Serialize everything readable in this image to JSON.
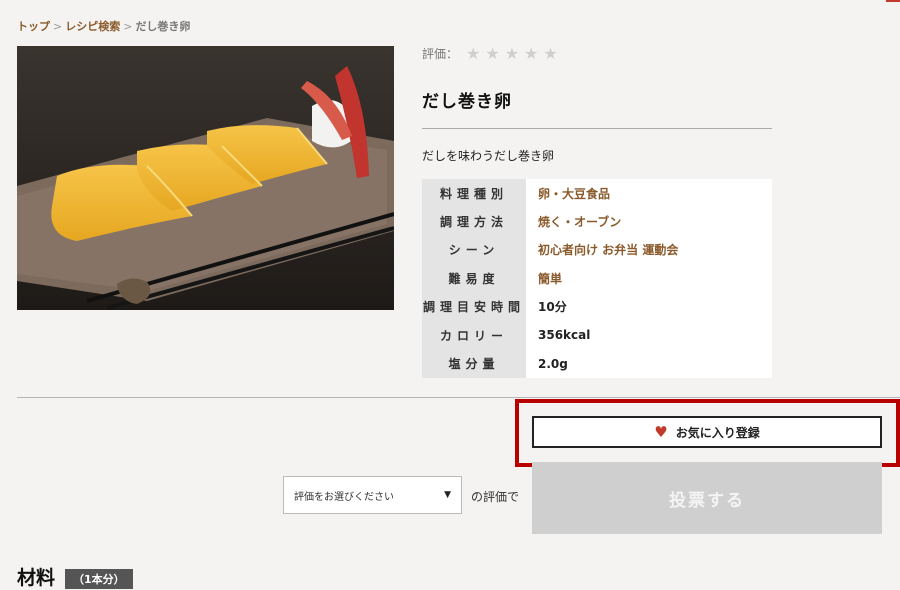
{
  "breadcrumb": {
    "home": "トップ",
    "search": "レシピ検索",
    "current": "だし巻き卵",
    "separator": ">"
  },
  "rating": {
    "label": "評価：",
    "max_stars": 5,
    "filled": 0
  },
  "recipe": {
    "title": "だし巻き卵",
    "description": "だしを味わうだし巻き卵",
    "info": [
      {
        "label": "料理種別",
        "value": "卵・大豆食品",
        "link": true
      },
      {
        "label": "調理方法",
        "value": "焼く・オーブン",
        "link": true
      },
      {
        "label": "シーン",
        "value": "初心者向け お弁当 運動会",
        "link": true
      },
      {
        "label": "難易度",
        "value": "簡単",
        "link": true
      },
      {
        "label": "調理目安時間",
        "value": "10分",
        "link": false
      },
      {
        "label": "カロリー",
        "value": "356kcal",
        "link": false
      },
      {
        "label": "塩分量",
        "value": "2.0g",
        "link": false
      }
    ]
  },
  "favorite": {
    "label": "お気に入り登録"
  },
  "vote": {
    "select_value": "評価をお選びください",
    "suffix": "の評価で",
    "button_label": "投票する"
  },
  "ingredients": {
    "title": "材料",
    "serving": "（1本分）"
  },
  "colors": {
    "accent": "#b80000",
    "link": "#8a5a2b",
    "heart": "#c0392b"
  },
  "icons": {
    "star": "star-icon",
    "heart": "heart-icon",
    "dropdown": "triangle-down-icon"
  }
}
